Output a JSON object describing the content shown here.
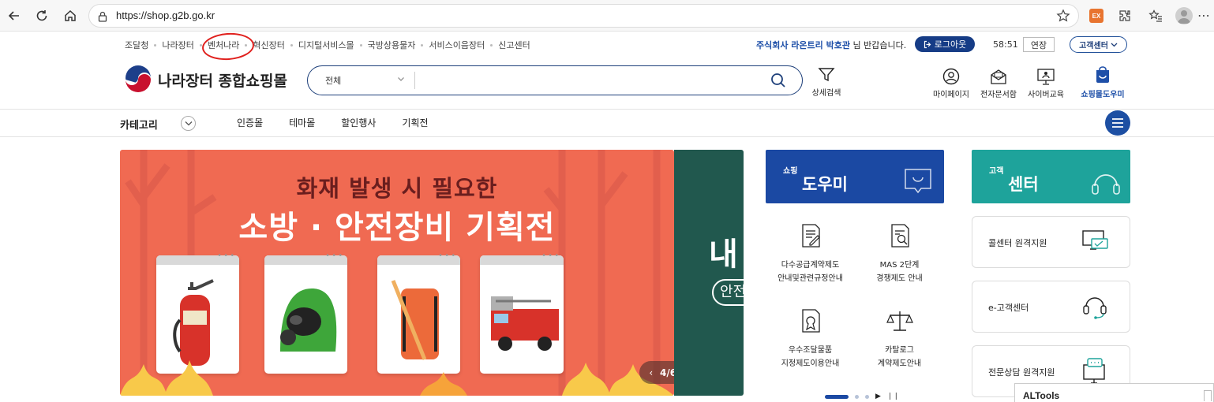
{
  "browser": {
    "url": "https://shop.g2b.go.kr",
    "ext_badge": "EX"
  },
  "util": {
    "links": [
      "조달청",
      "나라장터",
      "벤처나라",
      "혁신장터",
      "디지털서비스몰",
      "국방상용물자",
      "서비스이음장터",
      "신고센터"
    ],
    "company": "주식회사 라온트리 박호관",
    "greeting": "님 반갑습니다.",
    "logout": "로그아웃",
    "timer": "58:51",
    "extend": "연장",
    "customer_center": "고객센터"
  },
  "header": {
    "logo_text": "나라장터 종합쇼핑몰",
    "search_category": "전체",
    "search_placeholder": "",
    "detail_search": "상세검색",
    "menus": [
      "마이페이지",
      "전자문서함",
      "사이버교육",
      "쇼핑몰도우미"
    ]
  },
  "category": {
    "label": "카테고리",
    "tabs": [
      "인증몰",
      "테마몰",
      "할인행사",
      "기획전"
    ]
  },
  "banner": {
    "subtitle": "화재 발생 시 필요한",
    "title": "소방 · 안전장비 기획전",
    "counter": "4/6",
    "next_big": "내",
    "next_pill": "안전"
  },
  "helper": {
    "small": "쇼핑",
    "big": "도우미",
    "items": [
      {
        "line1": "다수공급계약제도",
        "line2": "안내및관련규정안내",
        "icon": "document-pen-icon"
      },
      {
        "line1": "MAS 2단계",
        "line2": "경쟁제도 안내",
        "icon": "document-search-icon"
      },
      {
        "line1": "우수조달물품",
        "line2": "지정제도이용안내",
        "icon": "certificate-icon"
      },
      {
        "line1": "카탈로그",
        "line2": "계약제도안내",
        "icon": "scale-icon"
      }
    ]
  },
  "cc": {
    "small": "고객",
    "big": "센터",
    "items": [
      "콜센터 원격지원",
      "e-고객센터",
      "전문상담 원격지원"
    ]
  },
  "popup": {
    "title": "ALTools"
  },
  "colors": {
    "brand_blue": "#1b49a3",
    "teal": "#1ea39b",
    "banner_red": "#f06a52",
    "annotation_red": "#e0201d"
  }
}
